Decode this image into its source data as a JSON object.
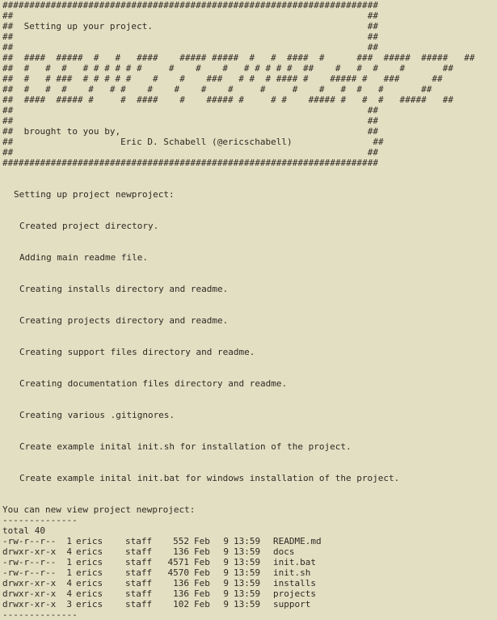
{
  "banner": {
    "lines": [
      "######################################################################",
      "##                                                                  ##",
      "##  Setting up your project.                                        ##",
      "##                                                                  ##",
      "##                                                                  ##",
      "##  ####  #####  #   #   ####    ##### #####  #   #  ####  #      ###  #####  #####   ##",
      "##  #   #  #   # # # # # #     #    #    #   # # # # #  ##    #   #  #    #       ##",
      "##  #   # ###  # # # # #    #    #    ###   # #  # #### #    ##### #   ###      ##",
      "##  #   #  #    #   # #    #    #    #    #     #     #    #   #  #   #       ##",
      "##  ####  ##### #     #  ####    #    ##### #     # #    ##### #   #  #   #####   ##",
      "##                                                                  ##",
      "##                                                                  ##",
      "##  brought to you by,                                              ##",
      "##                    Eric D. Schabell (@ericschabell)               ##",
      "##                                                                  ##",
      "######################################################################"
    ]
  },
  "setup_header": "Setting up project newproject:",
  "steps": [
    "Created project directory.",
    "Adding main readme file.",
    "Creating installs directory and readme.",
    "Creating projects directory and readme.",
    "Creating support files directory and readme.",
    "Creating documentation files directory and readme.",
    "Creating various .gitignores.",
    "Create example inital init.sh for installation of the project.",
    "Create example inital init.bat for windows installation of the project."
  ],
  "view_header": "You can new view project newproject:",
  "separator": "--------------",
  "total_line": "total 40",
  "listing": [
    {
      "perms": "-rw-r--r--",
      "links": "1",
      "owner": "erics",
      "group": "staff",
      "size": "552",
      "month": "Feb",
      "day": "9",
      "time": "13:59",
      "name": "README.md"
    },
    {
      "perms": "drwxr-xr-x",
      "links": "4",
      "owner": "erics",
      "group": "staff",
      "size": "136",
      "month": "Feb",
      "day": "9",
      "time": "13:59",
      "name": "docs"
    },
    {
      "perms": "-rw-r--r--",
      "links": "1",
      "owner": "erics",
      "group": "staff",
      "size": "4571",
      "month": "Feb",
      "day": "9",
      "time": "13:59",
      "name": "init.bat"
    },
    {
      "perms": "-rw-r--r--",
      "links": "1",
      "owner": "erics",
      "group": "staff",
      "size": "4570",
      "month": "Feb",
      "day": "9",
      "time": "13:59",
      "name": "init.sh"
    },
    {
      "perms": "drwxr-xr-x",
      "links": "4",
      "owner": "erics",
      "group": "staff",
      "size": "136",
      "month": "Feb",
      "day": "9",
      "time": "13:59",
      "name": "installs"
    },
    {
      "perms": "drwxr-xr-x",
      "links": "4",
      "owner": "erics",
      "group": "staff",
      "size": "136",
      "month": "Feb",
      "day": "9",
      "time": "13:59",
      "name": "projects"
    },
    {
      "perms": "drwxr-xr-x",
      "links": "3",
      "owner": "erics",
      "group": "staff",
      "size": "102",
      "month": "Feb",
      "day": "9",
      "time": "13:59",
      "name": "support"
    }
  ],
  "colors": {
    "background": "#e3dfc3",
    "text": "#2f2a22"
  }
}
